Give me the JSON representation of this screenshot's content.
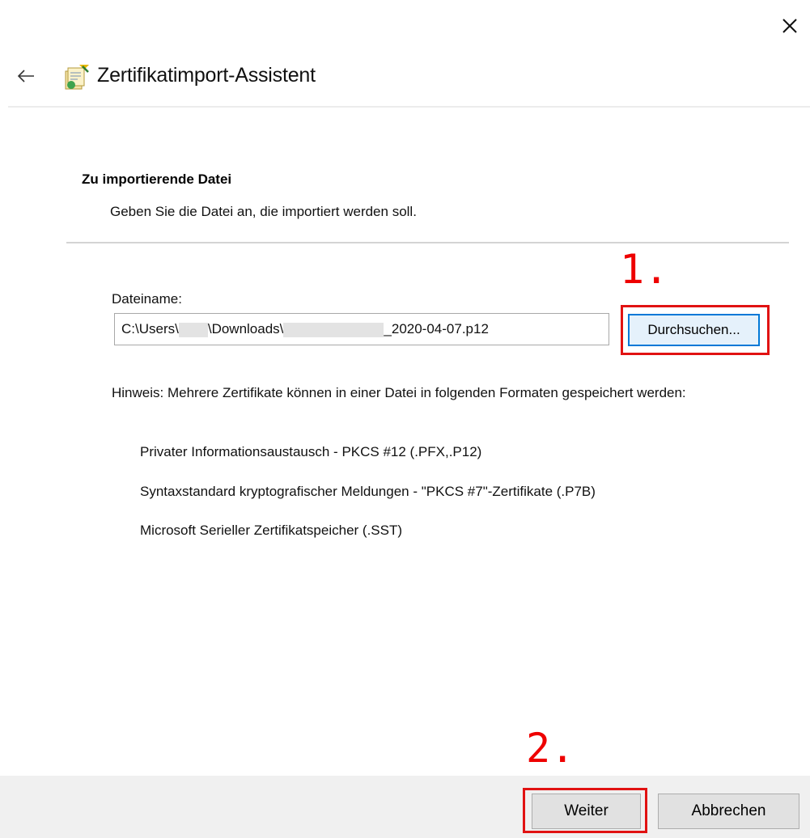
{
  "window": {
    "title": "Zertifikatimport-Assistent",
    "close_icon": "close-icon",
    "back_icon": "back-arrow-icon",
    "wizard_icon": "certificate-wizard-icon"
  },
  "section": {
    "heading": "Zu importierende Datei",
    "subtitle": "Geben Sie die Datei an, die importiert werden soll."
  },
  "file": {
    "label": "Dateiname:",
    "value_prefix": "C:\\Users\\",
    "value_mid": "\\Downloads\\",
    "value_suffix": "_2020-04-07.p12",
    "browse_label": "Durchsuchen..."
  },
  "hint": {
    "text": "Hinweis: Mehrere Zertifikate können in einer Datei in folgenden Formaten gespeichert werden:",
    "formats": [
      "Privater Informationsaustausch - PKCS #12 (.PFX,.P12)",
      "Syntaxstandard kryptografischer Meldungen - \"PKCS #7\"-Zertifikate (.P7B)",
      "Microsoft Serieller Zertifikatspeicher (.SST)"
    ]
  },
  "annotations": {
    "step1": "1.",
    "step2": "2.",
    "highlight_color": "#e11212"
  },
  "footer": {
    "next_label": "Weiter",
    "cancel_label": "Abbrechen"
  },
  "colors": {
    "focus_border": "#0078d7",
    "footer_bg": "#f0f0f0"
  }
}
